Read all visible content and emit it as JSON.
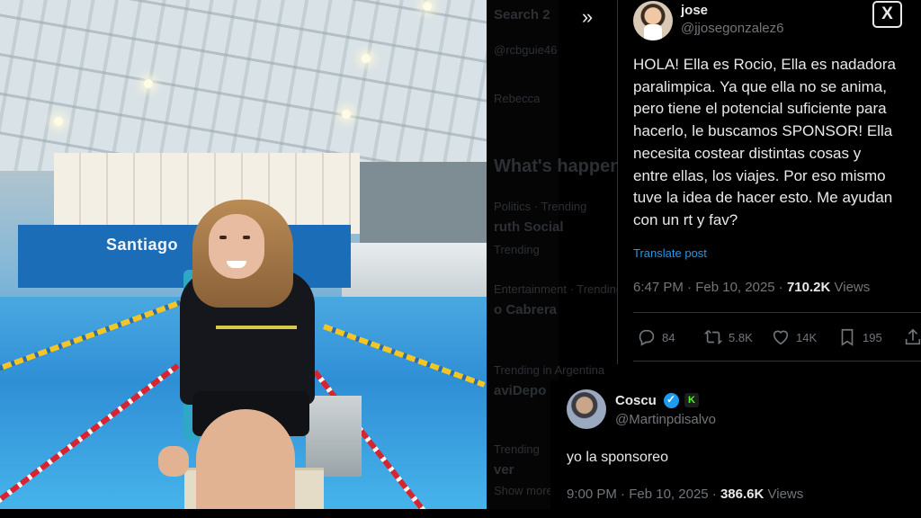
{
  "background_sidebar": {
    "faded_items": [
      "Search 2",
      "@rcbguie46",
      "Rebecca",
      "What's happening",
      "Politics · Trending",
      "ruth Social",
      "Trending",
      "Entertainment · Trending",
      "o Cabrera",
      "Trending in Argentina",
      "aviDepo",
      "Trending",
      "ver",
      "Show more"
    ]
  },
  "post": {
    "author_name": "jose",
    "author_handle": "@jjosegonzalez6",
    "body_lines": [
      "HOLA! Ella es Rocio, Ella es nadadora",
      "paralimpica. Ya que ella no se anima,",
      "pero tiene el potencial suficiente para",
      "hacerlo, le buscamos SPONSOR! Ella",
      "necesita costear distintas cosas y",
      "entre ellas, los viajes. Por eso mismo",
      "tuve la idea de hacer esto. Me ayudan",
      "con un rt y fav?"
    ],
    "translate_label": "Translate post",
    "time": "6:47 PM",
    "date": "Feb 10, 2025",
    "views_count": "710.2K",
    "views_label": "Views",
    "actions": {
      "replies": "84",
      "reposts": "5.8K",
      "likes": "14K",
      "bookmarks": "195"
    }
  },
  "reply": {
    "author_name": "Coscu",
    "author_handle": "@Martinpdisalvo",
    "badge_letter": "K",
    "body": "yo la sponsoreo",
    "time": "9:00 PM",
    "date": "Feb 10, 2025",
    "views_count": "386.6K",
    "views_label": "Views"
  },
  "photo": {
    "banner_text": "Santiago"
  },
  "colors": {
    "accent": "#1d9bf0",
    "background": "#000000",
    "muted_text": "#71767b",
    "primary_text": "#e7e9ea",
    "kick_green": "#53fc18"
  },
  "icons": {
    "expand": "chevrons-right-icon",
    "x_logo": "x-logo-icon",
    "reply": "comment-icon",
    "repost": "repost-icon",
    "like": "heart-icon",
    "bookmark": "bookmark-icon",
    "share": "share-icon",
    "verified": "verified-badge-icon"
  }
}
